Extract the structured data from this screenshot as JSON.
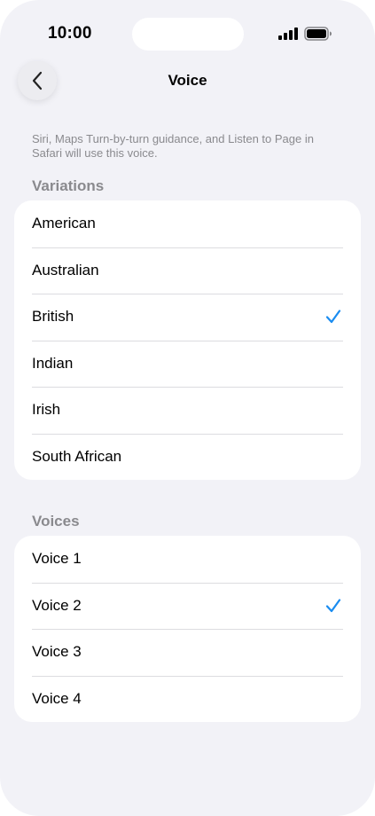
{
  "status_bar": {
    "time": "10:00"
  },
  "nav": {
    "title": "Voice",
    "back_icon": "chevron-left-icon"
  },
  "description": "Siri, Maps Turn-by-turn guidance, and Listen to Page in Safari will use this voice.",
  "variations": {
    "header": "Variations",
    "items": [
      {
        "label": "American",
        "selected": false
      },
      {
        "label": "Australian",
        "selected": false
      },
      {
        "label": "British",
        "selected": true
      },
      {
        "label": "Indian",
        "selected": false
      },
      {
        "label": "Irish",
        "selected": false
      },
      {
        "label": "South African",
        "selected": false
      }
    ]
  },
  "voices": {
    "header": "Voices",
    "items": [
      {
        "label": "Voice 1",
        "selected": false
      },
      {
        "label": "Voice 2",
        "selected": true
      },
      {
        "label": "Voice 3",
        "selected": false
      },
      {
        "label": "Voice 4",
        "selected": false
      }
    ]
  },
  "colors": {
    "background": "#f2f2f7",
    "accent": "#1a8cf0",
    "secondary_text": "#8a8a8e"
  }
}
